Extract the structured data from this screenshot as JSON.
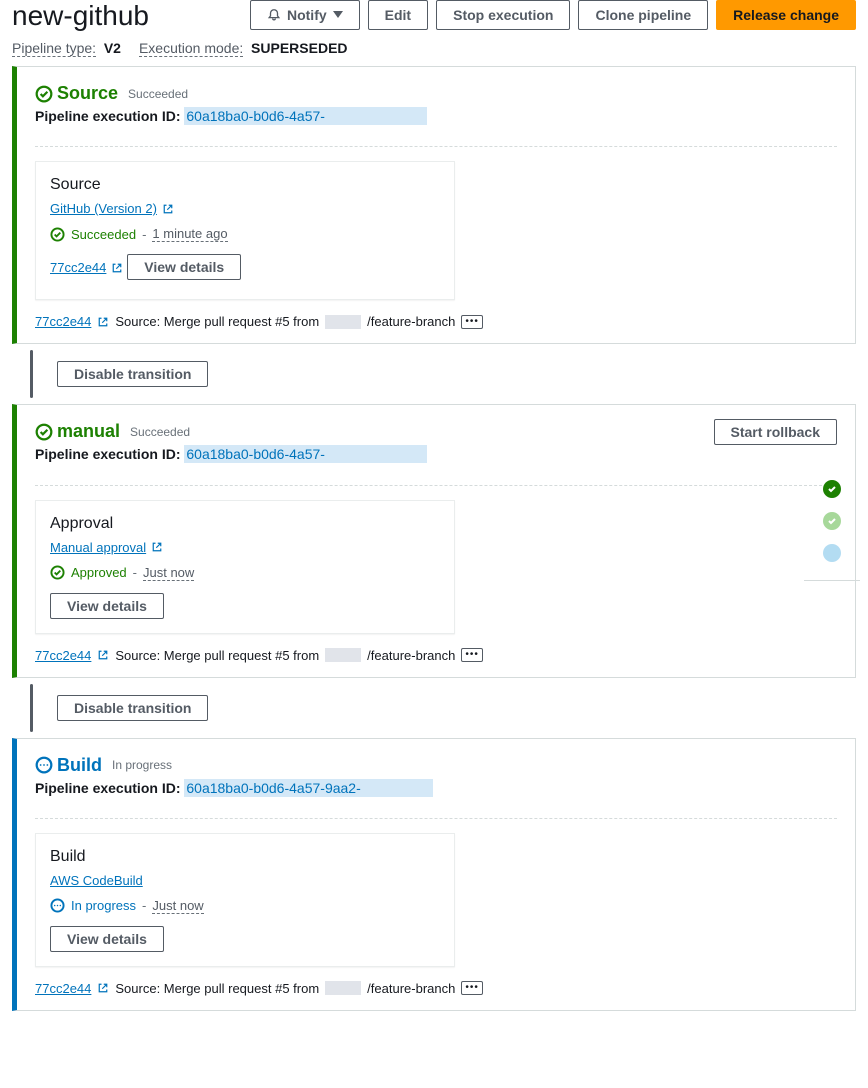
{
  "header": {
    "title": "new-github",
    "notify": "Notify",
    "edit": "Edit",
    "stop": "Stop execution",
    "clone": "Clone pipeline",
    "release": "Release change"
  },
  "meta": {
    "type_label": "Pipeline type:",
    "type_val": "V2",
    "mode_label": "Execution mode:",
    "mode_val": "SUPERSEDED"
  },
  "labels": {
    "exec_id": "Pipeline execution ID:",
    "view_details": "View details",
    "disable_transition": "Disable transition",
    "start_rollback": "Start rollback",
    "more": "•••"
  },
  "stages": [
    {
      "name": "Source",
      "status": "Succeeded",
      "exec_link": "60a18ba0-b0d6-4a57-",
      "action": {
        "title": "Source",
        "provider": "GitHub (Version 2)",
        "status": "Succeeded",
        "status_kind": "succ",
        "time": "1 minute ago",
        "commit": "77cc2e44"
      },
      "commit": {
        "hash": "77cc2e44",
        "msg_pre": "Source: Merge pull request #5 from",
        "msg_post": "/feature-branch"
      }
    },
    {
      "name": "manual",
      "status": "Succeeded",
      "exec_link": "60a18ba0-b0d6-4a57-",
      "rollback": true,
      "action": {
        "title": "Approval",
        "provider": "Manual approval",
        "status": "Approved",
        "status_kind": "succ",
        "time": "Just now"
      },
      "commit": {
        "hash": "77cc2e44",
        "msg_pre": "Source: Merge pull request #5 from",
        "msg_post": "/feature-branch"
      }
    },
    {
      "name": "Build",
      "status": "In progress",
      "exec_link": "60a18ba0-b0d6-4a57-9aa2-",
      "action": {
        "title": "Build",
        "provider": "AWS CodeBuild",
        "status": "In progress",
        "status_kind": "prog",
        "time": "Just now"
      },
      "commit": {
        "hash": "77cc2e44",
        "msg_pre": "Source: Merge pull request #5 from",
        "msg_post": "/feature-branch"
      }
    }
  ]
}
